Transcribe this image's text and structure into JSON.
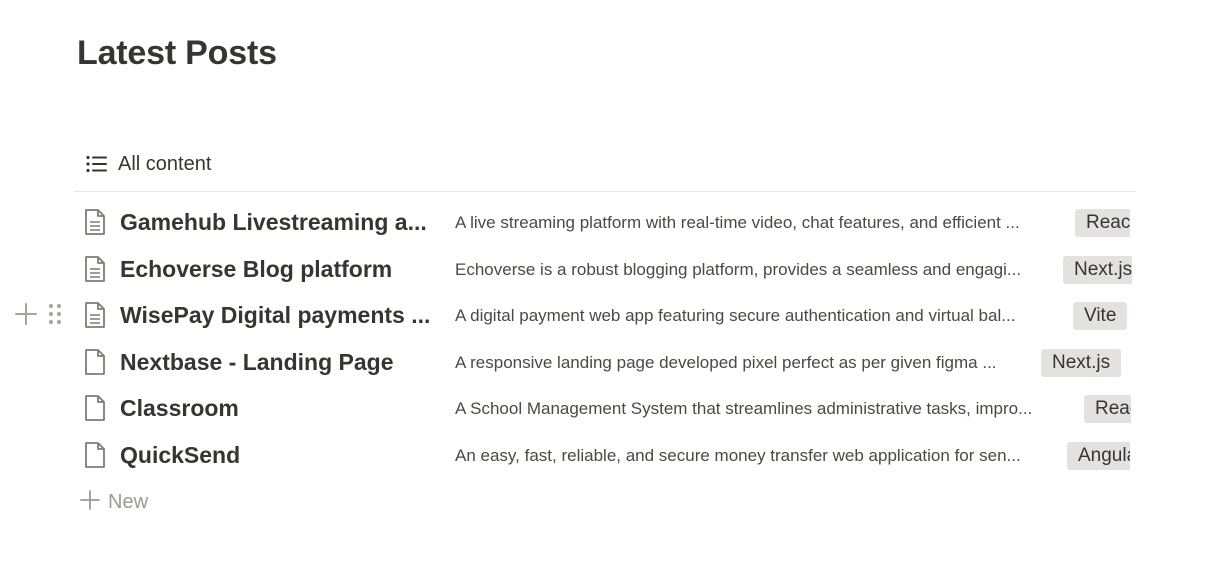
{
  "page": {
    "title": "Latest Posts"
  },
  "view": {
    "tab_label": "All content",
    "icon": "list-icon"
  },
  "rows": [
    {
      "title": "Gamehub Livestreaming a...",
      "description": "A live streaming platform with real-time video, chat features, and efficient ...",
      "tag": "React",
      "icon": "page-text-icon"
    },
    {
      "title": "Echoverse Blog platform",
      "description": "Echoverse is a robust blogging platform, provides a seamless and engagi...",
      "tag": "Next.js",
      "icon": "page-text-icon"
    },
    {
      "title": "WisePay Digital payments ...",
      "description": "A digital payment web app featuring secure authentication and virtual bal...",
      "tag": "Vite",
      "icon": "page-text-icon"
    },
    {
      "title": "Nextbase - Landing Page",
      "description": "A responsive landing page developed pixel perfect as per given figma ...",
      "tag": "Next.js",
      "icon": "page-blank-icon"
    },
    {
      "title": "Classroom",
      "description": "A School Management System that streamlines administrative tasks, impro...",
      "tag": "React",
      "icon": "page-blank-icon"
    },
    {
      "title": "QuickSend",
      "description": "An easy, fast, reliable, and secure money transfer web application for sen...",
      "tag": "Angular",
      "icon": "page-blank-icon"
    }
  ],
  "new_row": {
    "label": "New",
    "icon": "plus-icon"
  },
  "hover_controls": {
    "add_icon": "plus-icon",
    "drag_icon": "drag-handle-icon"
  }
}
